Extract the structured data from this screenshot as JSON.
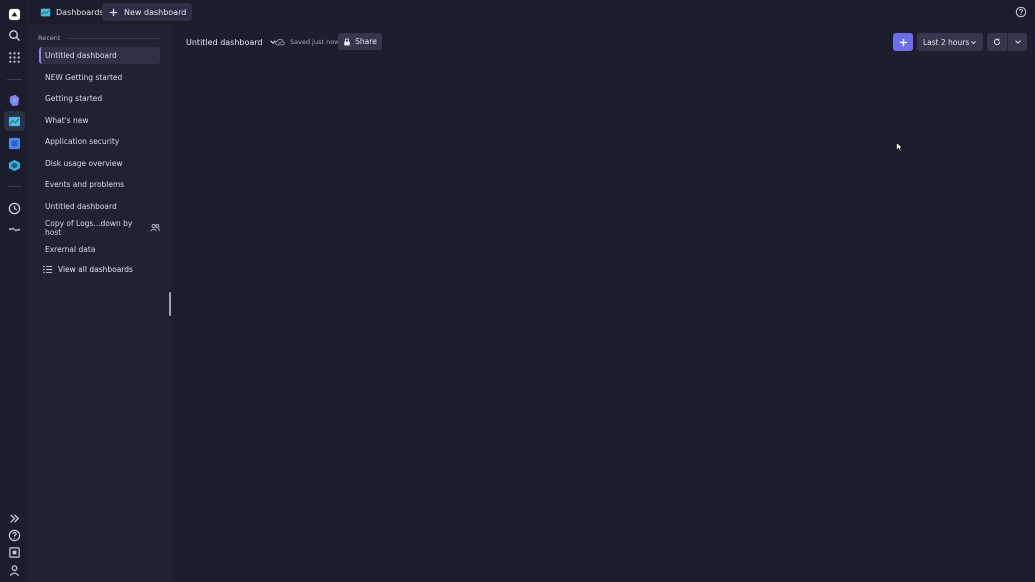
{
  "topbar": {
    "app_tab_label": "Dashboards",
    "new_dashboard_label": "New dashboard"
  },
  "sidebar": {
    "recent_label": "Recent",
    "items": [
      {
        "label": "Untitled dashboard",
        "active": true,
        "shared": false
      },
      {
        "label": "NEW Getting started",
        "active": false,
        "shared": false
      },
      {
        "label": "Getting started",
        "active": false,
        "shared": false
      },
      {
        "label": "What's new",
        "active": false,
        "shared": false
      },
      {
        "label": "Application security",
        "active": false,
        "shared": false
      },
      {
        "label": "Disk usage overview",
        "active": false,
        "shared": false
      },
      {
        "label": "Events and problems",
        "active": false,
        "shared": false
      },
      {
        "label": "Untitled dashboard",
        "active": false,
        "shared": false
      },
      {
        "label": "Copy of Logs...down by host",
        "active": false,
        "shared": true
      },
      {
        "label": "Exrernal data",
        "active": false,
        "shared": false
      }
    ],
    "view_all_label": "View all dashboards"
  },
  "main": {
    "title": "Untitled dashboard",
    "saved_status": "Saved just now",
    "share_label": "Share",
    "timeframe_label": "Last 2 hours"
  },
  "colors": {
    "accent": "#6c6fe8",
    "active_marker": "#8f7ff5",
    "background": "#1c1d2e"
  }
}
